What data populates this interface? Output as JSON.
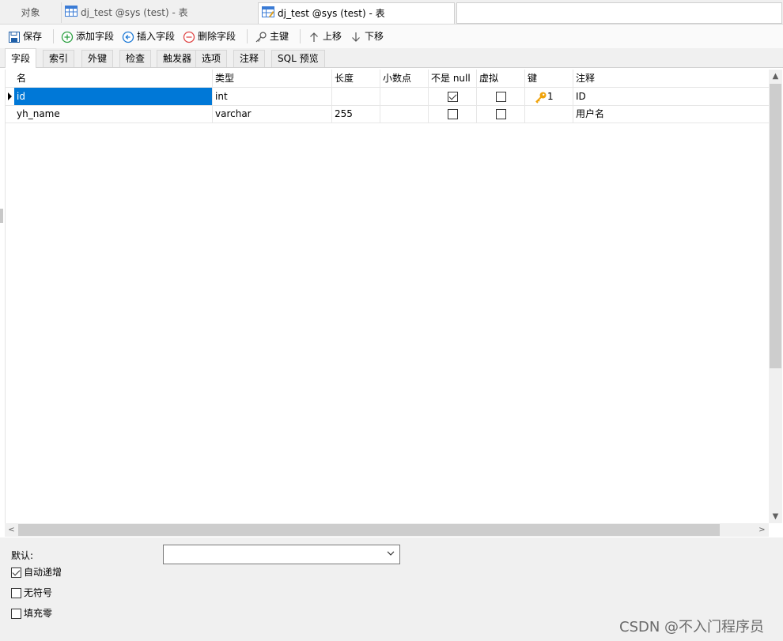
{
  "tabs": [
    {
      "label": "对象",
      "active": false
    },
    {
      "label": "dj_test @sys (test) - 表",
      "active": false
    },
    {
      "label": "dj_test @sys (test) - 表",
      "active": true
    }
  ],
  "toolbar": {
    "save": "保存",
    "add_field": "添加字段",
    "insert_field": "插入字段",
    "delete_field": "删除字段",
    "primary_key": "主键",
    "move_up": "上移",
    "move_down": "下移"
  },
  "subtabs": [
    "字段",
    "索引",
    "外键",
    "检查",
    "触发器",
    "选项",
    "注释",
    "SQL 预览"
  ],
  "grid": {
    "columns": [
      "名",
      "类型",
      "长度",
      "小数点",
      "不是 null",
      "虚拟",
      "键",
      "注释"
    ],
    "rows": [
      {
        "name": "id",
        "type": "int",
        "length": "",
        "decimals": "",
        "not_null": true,
        "virtual": false,
        "key": "1",
        "comment": "ID"
      },
      {
        "name": "yh_name",
        "type": "varchar",
        "length": "255",
        "decimals": "",
        "not_null": false,
        "virtual": false,
        "key": "",
        "comment": "用户名"
      }
    ]
  },
  "properties": {
    "default_label": "默认:",
    "default_value": "",
    "auto_increment": {
      "label": "自动递增",
      "checked": true
    },
    "unsigned": {
      "label": "无符号",
      "checked": false
    },
    "zerofill": {
      "label": "填充零",
      "checked": false
    }
  },
  "watermark": "CSDN @不入门程序员",
  "colors": {
    "selection": "#0078d7",
    "key_icon": "#f0a30a",
    "add_icon": "#2ea043",
    "insert_icon": "#1e7ad6",
    "delete_icon": "#e04848"
  }
}
